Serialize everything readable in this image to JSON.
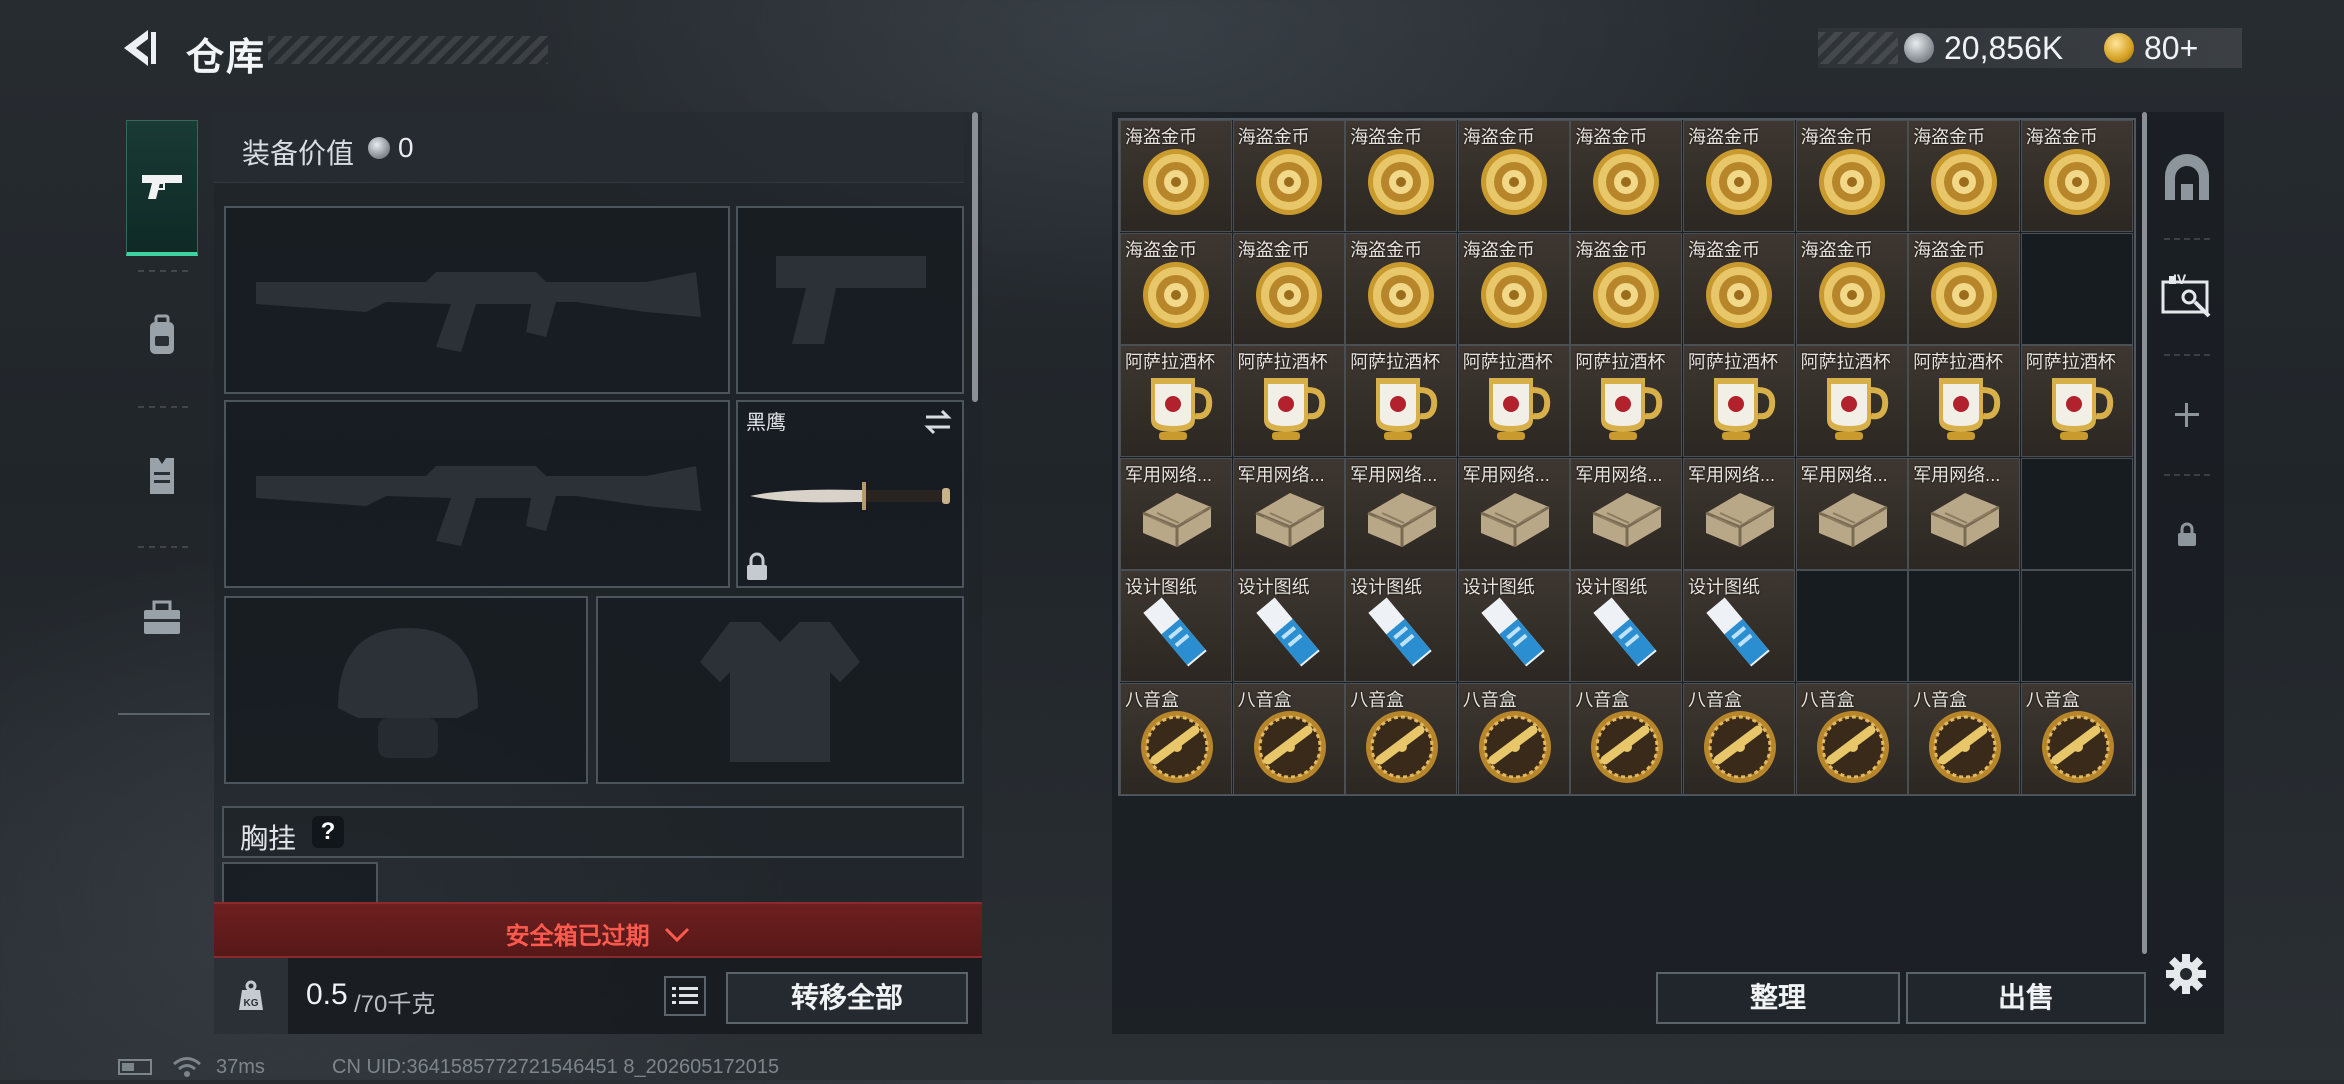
{
  "header": {
    "title": "仓库"
  },
  "currency": {
    "coins": "20,856K",
    "tickets": "80+"
  },
  "left_rail": {
    "tabs": [
      "weapon",
      "backpack",
      "vest",
      "toolbox"
    ]
  },
  "equipment": {
    "value_label": "装备价值",
    "value": "0",
    "knife_name": "黑鹰",
    "chest_rig_label": "胸挂",
    "chest_rig_help": "?"
  },
  "safebox": {
    "status": "安全箱已过期"
  },
  "carry": {
    "current": "0.5",
    "max": "/70千克",
    "weight_icon": "KG"
  },
  "buttons": {
    "transfer_all": "转移全部",
    "sort": "整理",
    "sell": "出售"
  },
  "storage": {
    "rows": [
      {
        "label": "海盗金币",
        "icon": "pirate-coin",
        "count": 9
      },
      {
        "label": "海盗金币",
        "icon": "pirate-coin",
        "count": 8
      },
      {
        "label": "阿萨拉酒杯",
        "icon": "golden-goblet",
        "count": 9
      },
      {
        "label": "军用网络...",
        "icon": "military-router",
        "count": 8
      },
      {
        "label": "设计图纸",
        "icon": "blueprint",
        "count": 6
      },
      {
        "label": "八音盒",
        "icon": "music-box",
        "count": 9
      }
    ]
  },
  "status": {
    "ping": "37ms",
    "uid": "CN UID:3641585772721546451 8_202605172015"
  }
}
